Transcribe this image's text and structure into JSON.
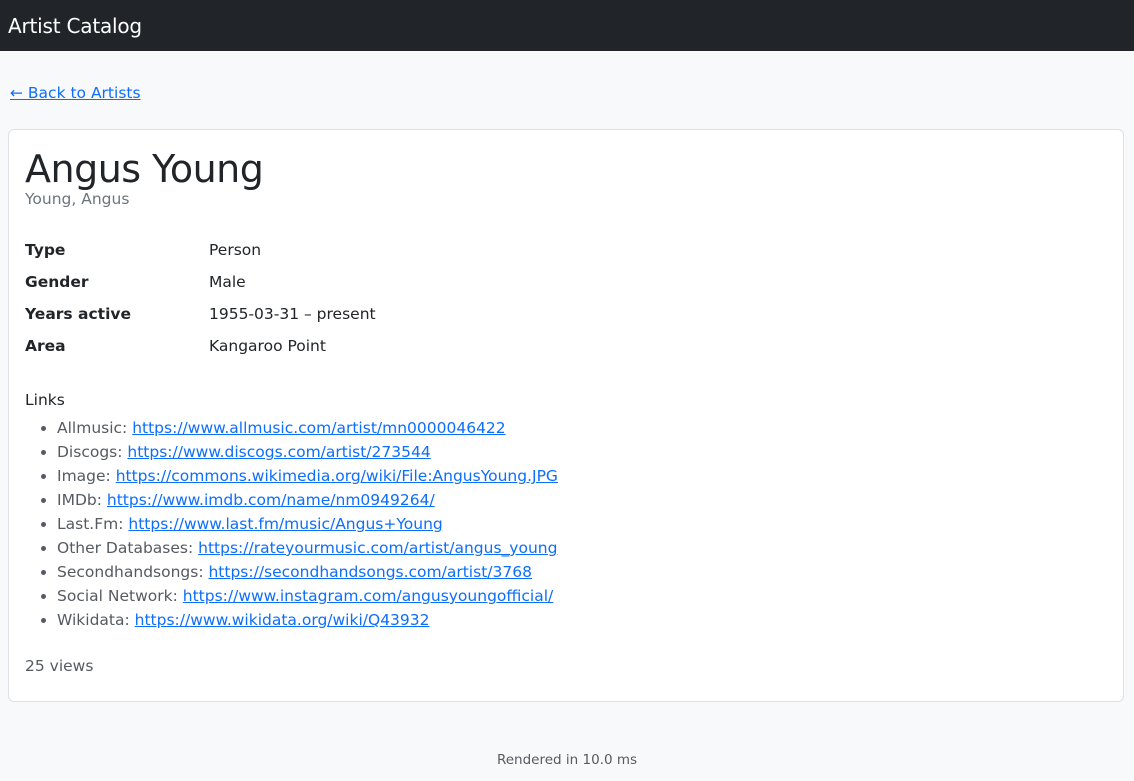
{
  "navbar": {
    "brand": "Artist Catalog"
  },
  "back_link": "← Back to Artists",
  "artist": {
    "name": "Angus Young",
    "sort_name": "Young, Angus",
    "details": [
      {
        "label": "Type",
        "value": "Person"
      },
      {
        "label": "Gender",
        "value": "Male"
      },
      {
        "label": "Years active",
        "value": "1955-03-31 – present"
      },
      {
        "label": "Area",
        "value": "Kangaroo Point"
      }
    ]
  },
  "links": {
    "heading": "Links",
    "items": [
      {
        "label": "Allmusic:",
        "url": "https://www.allmusic.com/artist/mn0000046422"
      },
      {
        "label": "Discogs:",
        "url": "https://www.discogs.com/artist/273544"
      },
      {
        "label": "Image:",
        "url": "https://commons.wikimedia.org/wiki/File:AngusYoung.JPG"
      },
      {
        "label": "IMDb:",
        "url": "https://www.imdb.com/name/nm0949264/"
      },
      {
        "label": "Last.Fm:",
        "url": "https://www.last.fm/music/Angus+Young"
      },
      {
        "label": "Other Databases:",
        "url": "https://rateyourmusic.com/artist/angus_young"
      },
      {
        "label": "Secondhandsongs:",
        "url": "https://secondhandsongs.com/artist/3768"
      },
      {
        "label": "Social Network:",
        "url": "https://www.instagram.com/angusyoungofficial/"
      },
      {
        "label": "Wikidata:",
        "url": "https://www.wikidata.org/wiki/Q43932"
      }
    ]
  },
  "views": "25 views",
  "footer": "Rendered in 10.0 ms",
  "colors": {
    "navbar_bg": "#212529",
    "link": "#0d6efd",
    "page_bg": "#f8f9fa"
  }
}
